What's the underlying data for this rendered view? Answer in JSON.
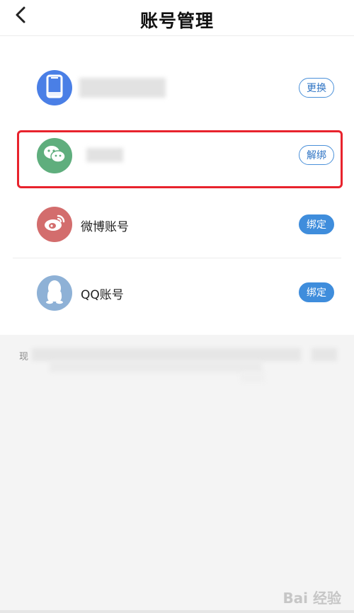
{
  "header": {
    "title": "账号管理"
  },
  "accounts": [
    {
      "label": "",
      "action": "更换"
    },
    {
      "label": "",
      "action": "解绑"
    },
    {
      "label": "微博账号",
      "action": "绑定"
    },
    {
      "label": "QQ账号",
      "action": "绑定"
    }
  ],
  "note": {
    "prefix": "现"
  },
  "watermark": "Bai 经验",
  "colors": {
    "phone_avatar": "#4a7fe6",
    "wechat_avatar": "#5fae7d",
    "weibo_avatar": "#d36d6d",
    "qq_avatar": "#8eb1d6",
    "button_blue": "#3f8ddc",
    "highlight_red": "#e8232d"
  }
}
